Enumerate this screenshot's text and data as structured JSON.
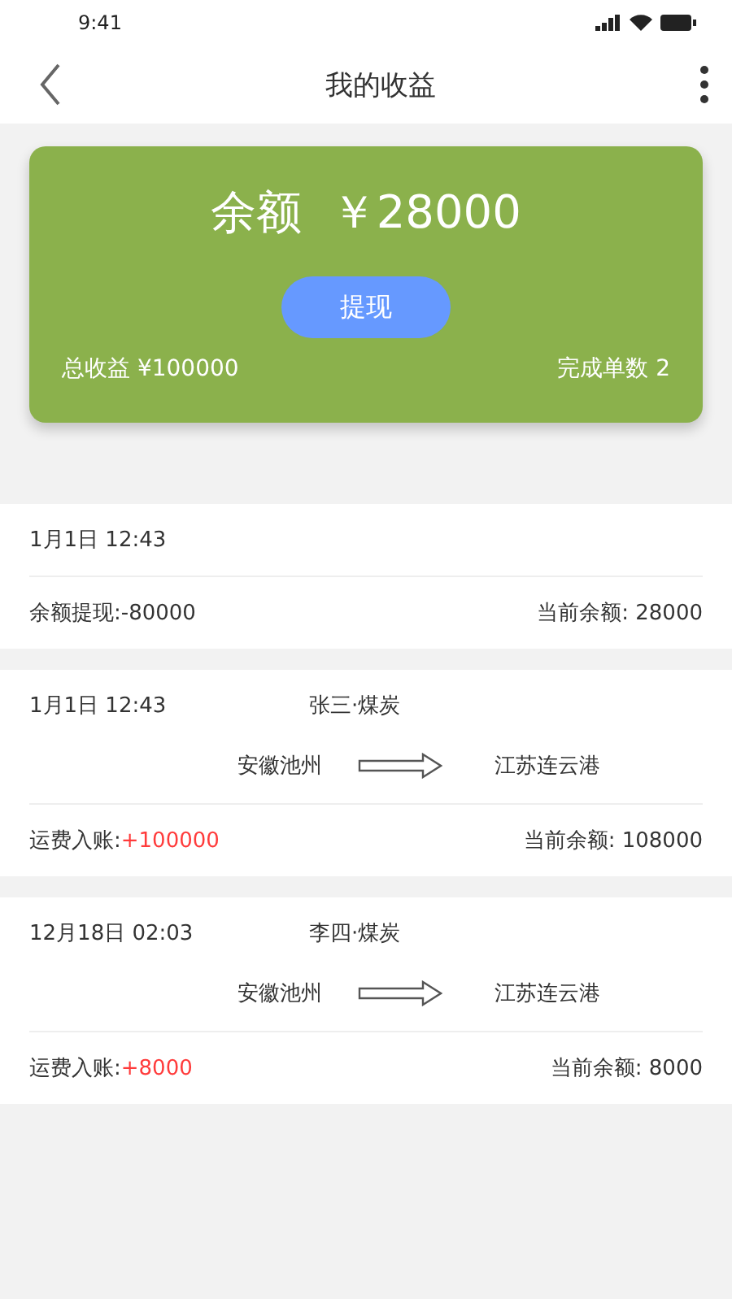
{
  "status_bar": {
    "time": "9:41"
  },
  "nav": {
    "title": "我的收益"
  },
  "summary": {
    "balance": "余额  ￥28000",
    "withdraw_button": "提现",
    "total_income": "总收益 ¥100000",
    "completed_orders": "完成单数 2"
  },
  "records": [
    {
      "kind": "withdrawal",
      "time": "1月1日 12:43",
      "label": "余额提现:",
      "amount": "-80000",
      "balance": "当前余额: 28000"
    },
    {
      "kind": "freight",
      "time": "1月1日 12:43",
      "cargo": "张三·煤炭",
      "origin": "安徽池州",
      "destination": "江苏连云港",
      "label": "运费入账:",
      "amount": "+100000",
      "balance": "当前余额: 108000"
    },
    {
      "kind": "freight",
      "time": "12月18日 02:03",
      "cargo": "李四·煤炭",
      "origin": "安徽池州",
      "destination": "江苏连云港",
      "label": "运费入账:",
      "amount": "+8000",
      "balance": "当前余额: 8000"
    }
  ]
}
